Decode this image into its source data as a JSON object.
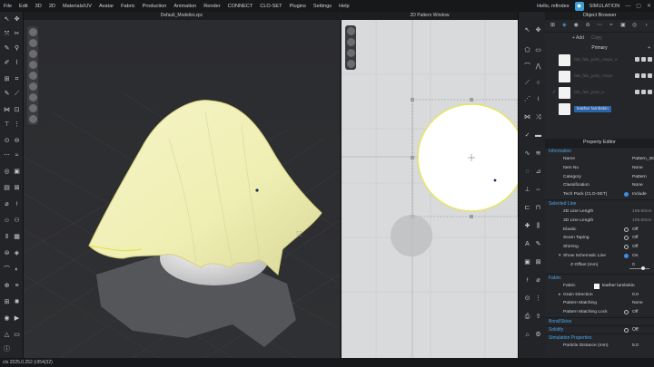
{
  "menu": [
    "File",
    "Edit",
    "3D",
    "2D",
    "Materials/UV",
    "Avatar",
    "Fabric",
    "Production",
    "Animation",
    "Render",
    "CONNECT",
    "CLO-SET",
    "Plugins",
    "Settings",
    "Help"
  ],
  "user": {
    "greeting": "Hello, mfindes"
  },
  "mode": {
    "label": "SIMULATION"
  },
  "viewport3d": {
    "title": "Default_Modelist.zpc"
  },
  "viewport2d": {
    "title": "2D Pattern Window"
  },
  "colors": {
    "accent": "#3aa0e6",
    "fabric": "#f3f2b8",
    "pattern_outline": "#e8e55a"
  },
  "object_browser": {
    "title": "Object Browser",
    "add_label": "Add",
    "copy_label": "Copy",
    "primary_label": "Primary",
    "items": [
      {
        "name": "fab_fab_post_crepe_e",
        "selected": false
      },
      {
        "name": "fab_fab_post_crepe",
        "selected": false
      },
      {
        "name": "fab_fab_post_e",
        "selected": false
      },
      {
        "name": "leather lambskin",
        "selected": true
      }
    ]
  },
  "property_editor": {
    "title": "Property Editor",
    "sections": {
      "information": "Information",
      "selected_line": "Selected Line",
      "fabric": "Fabric",
      "bond": "Bond/Skive",
      "solidify": "Solidify",
      "sim_props": "Simulation Properties"
    },
    "rows": {
      "name": {
        "label": "Name",
        "value": "Pattern_3D"
      },
      "item_no": {
        "label": "Item No",
        "value": "None"
      },
      "category": {
        "label": "Category",
        "value": "Pattern"
      },
      "classification": {
        "label": "Classification",
        "value": "None"
      },
      "tech_pack": {
        "label": "Tech Pack (CLO-SET)",
        "value": "Include"
      },
      "line_2d": {
        "label": "2D Line Length",
        "value": "106.60cm"
      },
      "line_3d": {
        "label": "3D Line Length",
        "value": "106.60cm"
      },
      "elastic": {
        "label": "Elastic",
        "value": "Off"
      },
      "seam_taping": {
        "label": "Seam Taping",
        "value": "Off"
      },
      "shirring": {
        "label": "Shirring",
        "value": "Off"
      },
      "schematic": {
        "label": "Show Schematic Line",
        "value": "On"
      },
      "z_offset": {
        "label": "Z-Offset (mm)",
        "value": "0"
      },
      "fabric": {
        "label": "Fabric",
        "value": "leather lambskin"
      },
      "grain": {
        "label": "Grain Direction",
        "value": "0.0"
      },
      "pattern_matching": {
        "label": "Pattern Matching",
        "value": "None"
      },
      "pattern_matching_lock": {
        "label": "Pattern Matching Lock",
        "value": "Off"
      },
      "solidify": {
        "label": "Solidify",
        "value": "Off"
      },
      "particle_distance": {
        "label": "Particle Distance (mm)",
        "value": "5.0"
      }
    }
  },
  "status": {
    "text": "clo 2025.0.252 (r354(32)"
  }
}
